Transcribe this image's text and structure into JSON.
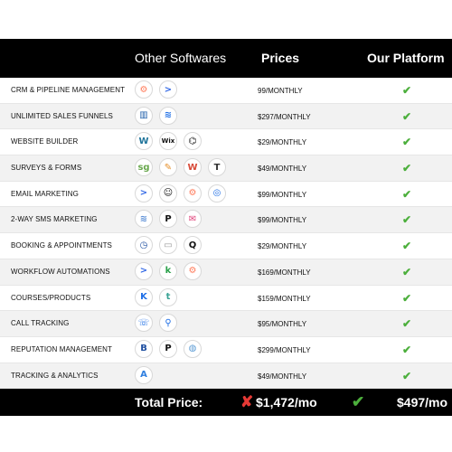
{
  "header": {
    "other_label": "Other Softwares",
    "prices_label": "Prices",
    "ours_label": "Our Platform"
  },
  "colors": {
    "check": "#4caf3c",
    "x_mark": "#e53935",
    "header_bg": "#000000"
  },
  "rows": [
    {
      "feature": "CRM & PIPELINE MANAGEMENT",
      "price": "99/MONTHLY",
      "icons": [
        {
          "name": "hubspot-icon",
          "glyph": "⚙",
          "color": "#ff7a59"
        },
        {
          "name": "activecampaign-icon",
          "glyph": ">",
          "color": "#356ae6"
        }
      ]
    },
    {
      "feature": "UNLIMITED SALES FUNNELS",
      "price": "$297/MONTHLY",
      "icons": [
        {
          "name": "clickfunnels-icon",
          "glyph": "▥",
          "color": "#1f5faa"
        },
        {
          "name": "layers-icon",
          "glyph": "≋",
          "color": "#1f6fe6"
        }
      ]
    },
    {
      "feature": "WEBSITE BUILDER",
      "price": "$29/MONTHLY",
      "icons": [
        {
          "name": "wordpress-icon",
          "glyph": "W",
          "color": "#21759b"
        },
        {
          "name": "wix-icon",
          "glyph": "Wix",
          "color": "#111111"
        },
        {
          "name": "squarespace-icon",
          "glyph": "⌬",
          "color": "#111111"
        }
      ]
    },
    {
      "feature": "SURVEYS & FORMS",
      "price": "$49/MONTHLY",
      "icons": [
        {
          "name": "surveygizmo-icon",
          "glyph": "sg",
          "color": "#6aa84f"
        },
        {
          "name": "jotform-icon",
          "glyph": "✎",
          "color": "#e6902c"
        },
        {
          "name": "wufoo-icon",
          "glyph": "W",
          "color": "#d84a38"
        },
        {
          "name": "typeform-icon",
          "glyph": "T",
          "color": "#333333"
        }
      ]
    },
    {
      "feature": "EMAIL MARKETING",
      "price": "$99/MONTHLY",
      "icons": [
        {
          "name": "activecampaign-icon",
          "glyph": ">",
          "color": "#356ae6"
        },
        {
          "name": "mailchimp-icon",
          "glyph": "☺",
          "color": "#111111"
        },
        {
          "name": "hubspot-icon",
          "glyph": "⚙",
          "color": "#ff7a59"
        },
        {
          "name": "constant-contact-icon",
          "glyph": "◎",
          "color": "#1f6fe6"
        }
      ]
    },
    {
      "feature": "2-WAY SMS MARKETING",
      "price": "$99/MONTHLY",
      "icons": [
        {
          "name": "sms-stack-icon",
          "glyph": "≋",
          "color": "#5b8fd6"
        },
        {
          "name": "podium-icon",
          "glyph": "P",
          "color": "#111111"
        },
        {
          "name": "message-icon",
          "glyph": "✉",
          "color": "#e0427a"
        }
      ]
    },
    {
      "feature": "BOOKING & APPOINTMENTS",
      "price": "$29/MONTHLY",
      "icons": [
        {
          "name": "calendly-icon",
          "glyph": "◷",
          "color": "#1f4fa0"
        },
        {
          "name": "calendar-icon",
          "glyph": "▭",
          "color": "#999999"
        },
        {
          "name": "acuity-icon",
          "glyph": "Q",
          "color": "#111111"
        }
      ]
    },
    {
      "feature": "WORKFLOW AUTOMATIONS",
      "price": "$169/MONTHLY",
      "icons": [
        {
          "name": "activecampaign-icon",
          "glyph": ">",
          "color": "#356ae6"
        },
        {
          "name": "keap-icon",
          "glyph": "k",
          "color": "#2ba14b"
        },
        {
          "name": "hubspot-icon",
          "glyph": "⚙",
          "color": "#ff7a59"
        }
      ]
    },
    {
      "feature": "COURSES/PRODUCTS",
      "price": "$159/MONTHLY",
      "icons": [
        {
          "name": "kajabi-icon",
          "glyph": "K",
          "color": "#1f6fe6"
        },
        {
          "name": "teachable-icon",
          "glyph": "t",
          "color": "#3aa395"
        }
      ]
    },
    {
      "feature": "CALL TRACKING",
      "price": "$95/MONTHLY",
      "icons": [
        {
          "name": "callrail-icon",
          "glyph": "☏",
          "color": "#1f6fe6"
        },
        {
          "name": "location-pin-icon",
          "glyph": "⚲",
          "color": "#1f6fe6"
        }
      ]
    },
    {
      "feature": "REPUTATION MANAGEMENT",
      "price": "$299/MONTHLY",
      "icons": [
        {
          "name": "birdeye-icon",
          "glyph": "B",
          "color": "#1f4fa0"
        },
        {
          "name": "podium-icon",
          "glyph": "P",
          "color": "#111111"
        },
        {
          "name": "globe-icon",
          "glyph": "◍",
          "color": "#5b9bd5"
        }
      ]
    },
    {
      "feature": "TRACKING & ANALYTICS",
      "price": "$49/MONTHLY",
      "icons": [
        {
          "name": "analytics-icon",
          "glyph": "A",
          "color": "#2f7fe0"
        }
      ]
    }
  ],
  "footer": {
    "label": "Total Price:",
    "total": "$1,472/mo",
    "ours_price": "$497/mo"
  }
}
